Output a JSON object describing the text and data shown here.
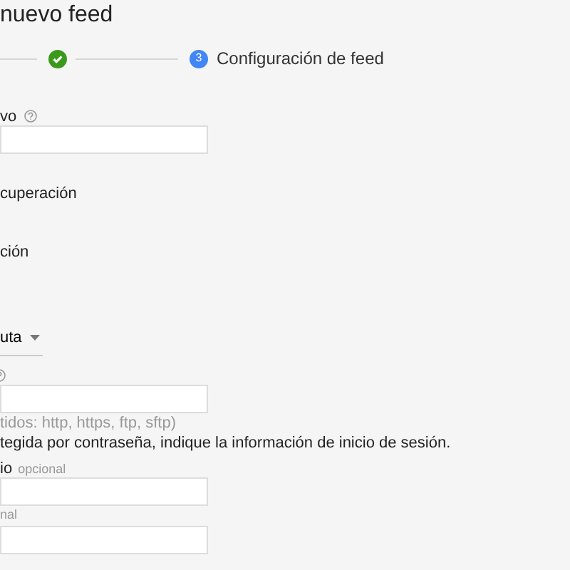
{
  "page_title": "nuevo feed",
  "steps": [
    {
      "done": true
    },
    {
      "number": "3",
      "label": "Configuración de feed",
      "done": false,
      "current": true
    }
  ],
  "fields": [
    {
      "kind": "input",
      "label": "vo",
      "help": true
    },
    {
      "kind": "text",
      "label": "cuperación"
    },
    {
      "kind": "text",
      "label": "ción"
    },
    {
      "kind": "select",
      "value": "uta"
    },
    {
      "kind": "input",
      "help": true,
      "hint": "tidos: http, https, ftp, sftp)"
    },
    {
      "kind": "note",
      "label": "tegida por contraseña, indique la información de inicio de sesión."
    },
    {
      "kind": "input",
      "label": "io",
      "optional": "opcional"
    },
    {
      "kind": "input",
      "optional": "nal"
    }
  ]
}
